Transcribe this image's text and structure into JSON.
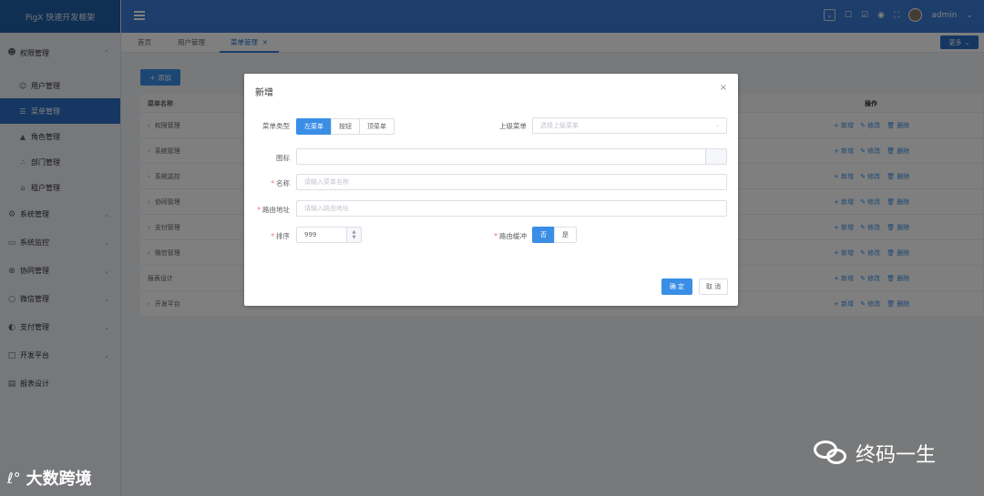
{
  "app": {
    "title": "PigX 快速开发框架"
  },
  "sidebar": {
    "groups": [
      {
        "label": "权限管理",
        "icon": "user-icon",
        "expanded": true,
        "items": [
          {
            "label": "用户管理",
            "icon": "users-icon"
          },
          {
            "label": "菜单管理",
            "icon": "list-icon",
            "active": true
          },
          {
            "label": "角色管理",
            "icon": "graduation-cap-icon"
          },
          {
            "label": "部门管理",
            "icon": "tree-icon"
          },
          {
            "label": "租户管理",
            "icon": "home-icon"
          }
        ]
      },
      {
        "label": "系统管理",
        "icon": "gear-icon"
      },
      {
        "label": "系统监控",
        "icon": "monitor-icon"
      },
      {
        "label": "协同管理",
        "icon": "cycle-icon"
      },
      {
        "label": "微信管理",
        "icon": "chat-icon"
      },
      {
        "label": "支付管理",
        "icon": "payment-icon"
      },
      {
        "label": "开发平台",
        "icon": "code-icon"
      },
      {
        "label": "报表设计",
        "icon": "chart-icon"
      }
    ]
  },
  "header": {
    "user": "admin"
  },
  "tabs": [
    {
      "label": "首页"
    },
    {
      "label": "用户管理"
    },
    {
      "label": "菜单管理",
      "active": true
    }
  ],
  "more_label": "更多",
  "toolbar": {
    "add_label": "+ 添加"
  },
  "table": {
    "headers": {
      "name": "菜单名称",
      "ops": "操作"
    },
    "rows": [
      {
        "name": "权限管理",
        "expandable": true
      },
      {
        "name": "系统管理",
        "expandable": true
      },
      {
        "name": "系统监控",
        "expandable": true
      },
      {
        "name": "协同管理",
        "expandable": true
      },
      {
        "name": "支付管理",
        "expandable": true
      },
      {
        "name": "微信管理",
        "expandable": true
      },
      {
        "name": "报表设计",
        "expandable": false
      },
      {
        "name": "开发平台",
        "expandable": true
      }
    ],
    "ops": {
      "add": "+ 新增",
      "edit": "✎ 修改",
      "delete": "🗑 删除"
    }
  },
  "dialog": {
    "title": "新增",
    "close": "×",
    "menu_type": {
      "label": "菜单类型",
      "options": [
        "左菜单",
        "按钮",
        "顶菜单"
      ],
      "selected": "左菜单"
    },
    "parent_menu": {
      "label": "上级菜单",
      "placeholder": "选择上级菜单"
    },
    "icon_field": {
      "label": "图标"
    },
    "name_field": {
      "label": "名称",
      "placeholder": "请输入菜单名称"
    },
    "route_field": {
      "label": "路由地址",
      "placeholder": "请输入路由地址"
    },
    "sort_field": {
      "label": "排序",
      "value": "999"
    },
    "route_cache": {
      "label": "路由缓冲",
      "options": [
        "否",
        "是"
      ],
      "selected": "否"
    },
    "confirm_label": "确 定",
    "cancel_label": "取 消"
  },
  "watermarks": {
    "left": "大数跨境",
    "right": "终码一生"
  },
  "colors": {
    "header": "#3a7bd5",
    "logo_bg": "#1e5fa6",
    "accent": "#3a8ee6",
    "active_menu": "#2d6ec3"
  }
}
